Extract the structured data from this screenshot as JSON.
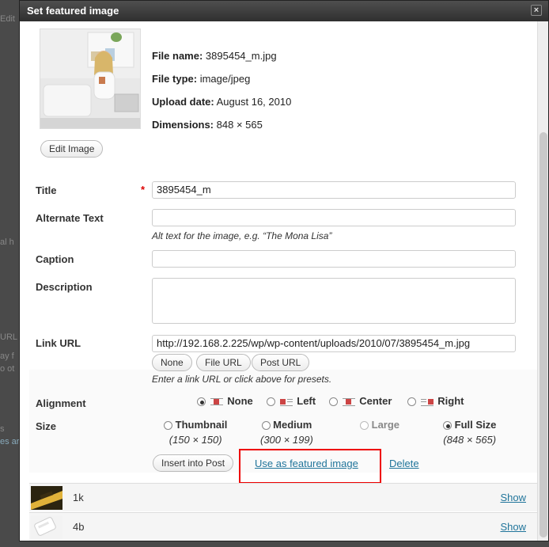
{
  "background": {
    "fragments": [
      "Edit",
      "al h",
      "URL",
      "ay f",
      "o ot",
      "s",
      "es ar"
    ]
  },
  "dialog": {
    "title": "Set featured image",
    "close_label": "×"
  },
  "image": {
    "file_name_label": "File name:",
    "file_name": "3895454_m.jpg",
    "file_type_label": "File type:",
    "file_type": "image/jpeg",
    "upload_date_label": "Upload date:",
    "upload_date": "August 16, 2010",
    "dimensions_label": "Dimensions:",
    "dimensions": "848 × 565",
    "edit_button": "Edit Image"
  },
  "form": {
    "title_label": "Title",
    "required_mark": "*",
    "title_value": "3895454_m",
    "alt_label": "Alternate Text",
    "alt_value": "",
    "alt_help": "Alt text for the image, e.g. “The Mona Lisa”",
    "caption_label": "Caption",
    "caption_value": "",
    "description_label": "Description",
    "description_value": "",
    "link_label": "Link URL",
    "link_value": "http://192.168.2.225/wp/wp-content/uploads/2010/07/3895454_m.jpg",
    "link_buttons": [
      "None",
      "File URL",
      "Post URL"
    ],
    "link_help": "Enter a link URL or click above for presets.",
    "alignment_label": "Alignment",
    "alignment_options": [
      "None",
      "Left",
      "Center",
      "Right"
    ],
    "alignment_selected": "None",
    "size_label": "Size",
    "size_options": [
      {
        "name": "Thumbnail",
        "dims": "(150 × 150)"
      },
      {
        "name": "Medium",
        "dims": "(300 × 199)"
      },
      {
        "name": "Large",
        "dims": ""
      },
      {
        "name": "Full Size",
        "dims": "(848 × 565)"
      }
    ],
    "size_selected": "Full Size",
    "insert_button": "Insert into Post",
    "featured_link": "Use as featured image",
    "delete_link": "Delete"
  },
  "items": [
    {
      "name": "1k",
      "action": "Show"
    },
    {
      "name": "4b",
      "action": "Show"
    }
  ],
  "colors": {
    "link": "#21759b",
    "highlight": "#e00000",
    "titlebar": "#3a3a3a"
  }
}
